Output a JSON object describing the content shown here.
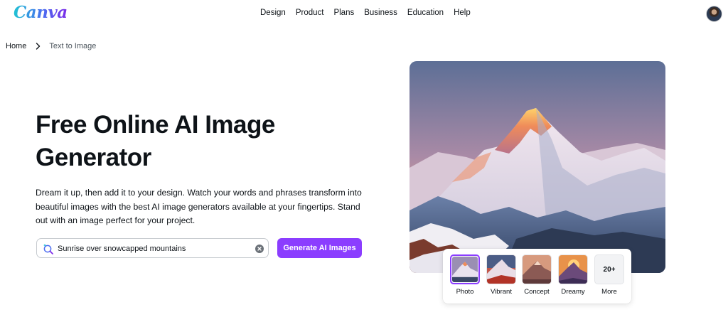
{
  "header": {
    "logo": "Canva",
    "nav": [
      "Design",
      "Product",
      "Plans",
      "Business",
      "Education",
      "Help"
    ]
  },
  "breadcrumb": {
    "home": "Home",
    "current": "Text to Image"
  },
  "hero": {
    "title": "Free Online AI Image Generator",
    "description": "Dream it up, then add it to your design. Watch your words and phrases transform into beautiful images with the best AI image generators available at your fingertips. Stand out with an image perfect for your project."
  },
  "prompt": {
    "value": "Sunrise over snowcapped mountains",
    "button": "Generate AI Images"
  },
  "styles": {
    "items": [
      {
        "label": "Photo",
        "selected": true
      },
      {
        "label": "Vibrant",
        "selected": false
      },
      {
        "label": "Concept",
        "selected": false
      },
      {
        "label": "Dreamy",
        "selected": false
      }
    ],
    "more": {
      "count": "20+",
      "label": "More"
    }
  },
  "colors": {
    "brand_purple": "#8b3dff",
    "text": "#0e1318"
  }
}
